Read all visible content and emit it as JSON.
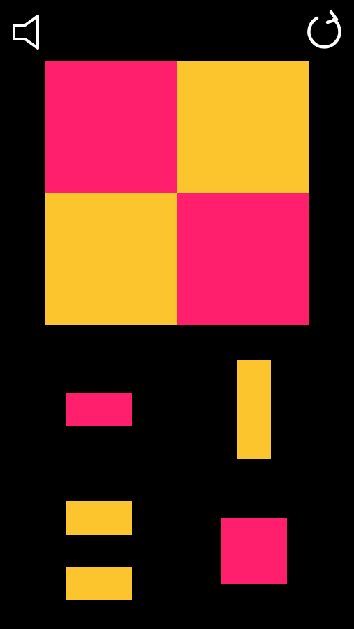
{
  "colors": {
    "background": "#000000",
    "pink": "#FF1F6C",
    "yellow": "#FDC52D",
    "icon": "#FFFFFF"
  },
  "toolbar": {
    "sound_icon": "speaker-icon",
    "restart_icon": "restart-icon"
  },
  "board": {
    "rows": 2,
    "cols": 2,
    "cells": [
      [
        "pink",
        "yellow"
      ],
      [
        "yellow",
        "pink"
      ]
    ]
  },
  "pieces": [
    {
      "id": "piece-1",
      "shape": "horizontal-bar",
      "color": "pink"
    },
    {
      "id": "piece-2",
      "shape": "vertical-bar",
      "color": "yellow"
    },
    {
      "id": "piece-3",
      "shape": "horizontal-bar",
      "color": "yellow"
    },
    {
      "id": "piece-4",
      "shape": "square",
      "color": "pink"
    },
    {
      "id": "piece-5",
      "shape": "horizontal-bar",
      "color": "yellow"
    }
  ]
}
